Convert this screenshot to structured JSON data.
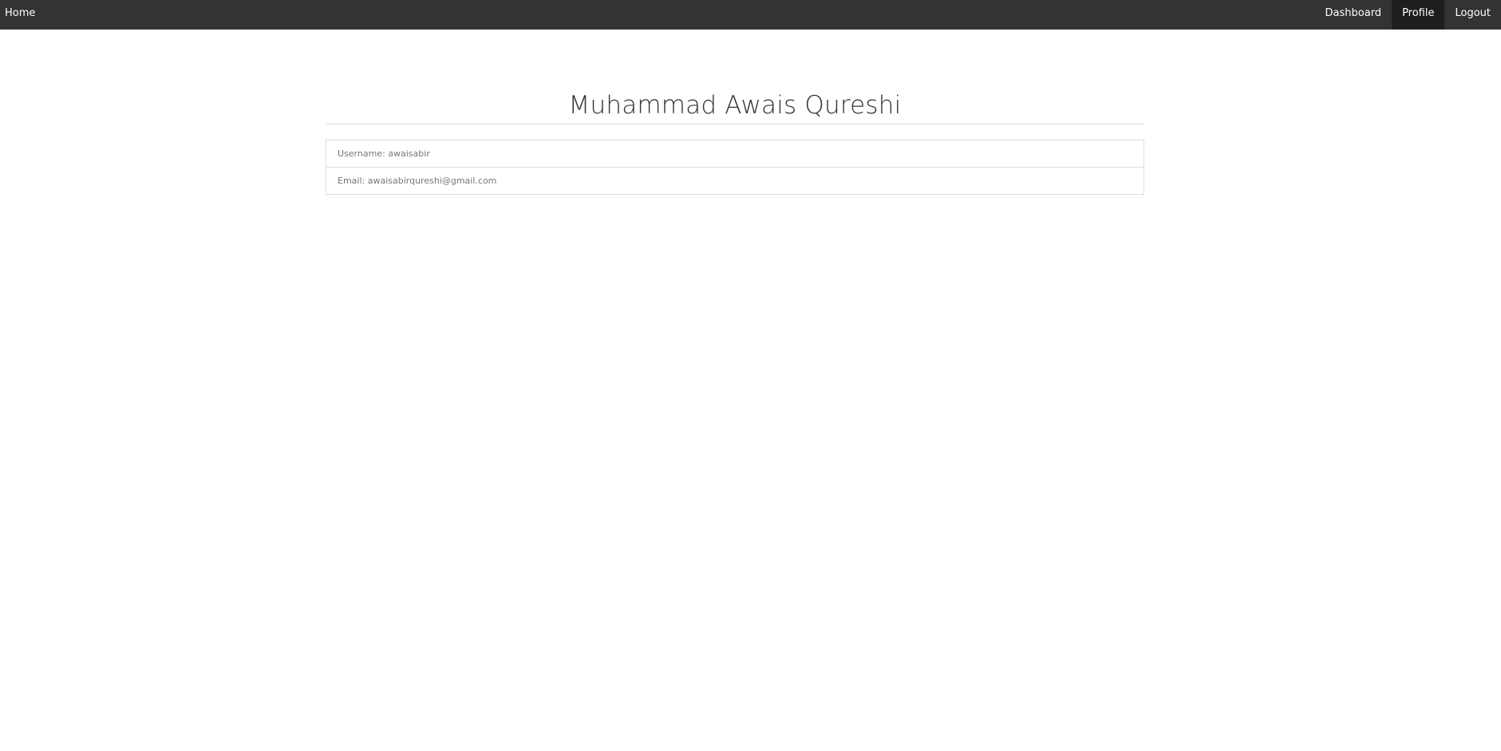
{
  "navbar": {
    "home_label": "Home",
    "links": [
      {
        "label": "Dashboard",
        "active": false
      },
      {
        "label": "Profile",
        "active": true
      },
      {
        "label": "Logout",
        "active": false
      }
    ]
  },
  "profile": {
    "name": "Muhammad Awais Qureshi",
    "username_text": "Username: awaisabir",
    "email_text": "Email: awaisabirqureshi@gmail.com"
  },
  "colors": {
    "navbar_bg": "#333333",
    "navbar_active_bg": "#1e1e1e",
    "border": "#dddddd",
    "text_muted": "#777777",
    "title_text": "#333333"
  }
}
